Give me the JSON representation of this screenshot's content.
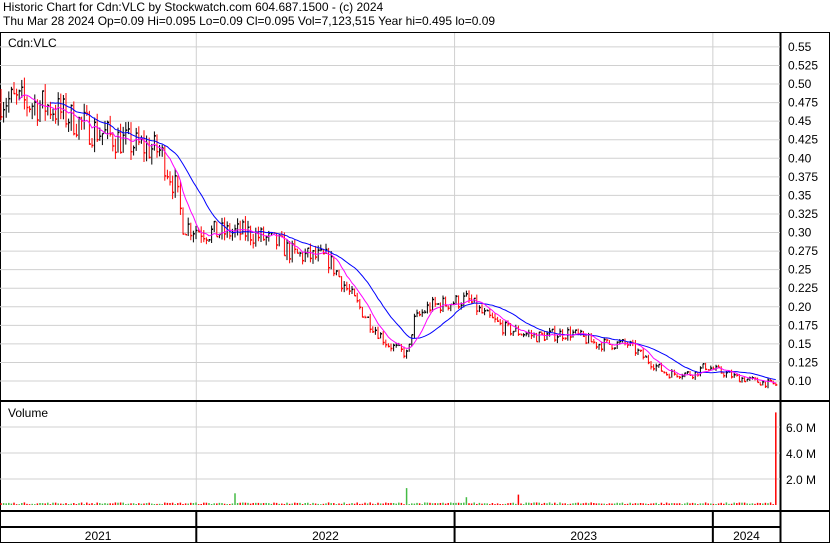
{
  "header": {
    "title": "Historic Chart for Cdn:VLC by Stockwatch.com 604.687.1500 - (c) 2024",
    "quote": "Thu Mar 28 2024   Op=0.09  Hi=0.095  Lo=0.09  Cl=0.095  Vol=7,123,515   Year hi=0.495  lo=0.09"
  },
  "chart_data": {
    "type": "line",
    "title": "Cdn:VLC",
    "price_pane": {
      "label": "Cdn:VLC",
      "ylim": [
        0.085,
        0.565
      ],
      "y_ticks": [
        "0.55",
        "0.525",
        "0.50",
        "0.475",
        "0.45",
        "0.425",
        "0.40",
        "0.375",
        "0.35",
        "0.325",
        "0.30",
        "0.275",
        "0.25",
        "0.225",
        "0.20",
        "0.175",
        "0.15",
        "0.125",
        "0.10"
      ],
      "series_colors": {
        "bars_up": "#000000",
        "bars_down": "#ff0000",
        "ma_short": "#ff00ff",
        "ma_long": "#0000ff"
      },
      "close_keypoints": {
        "x_year": [
          2021.24,
          2021.43,
          2021.59,
          2021.74,
          2021.86,
          2021.92,
          2021.95,
          2022.05,
          2022.2,
          2022.32,
          2022.38,
          2022.51,
          2022.59,
          2022.67,
          2022.74,
          2022.82,
          2022.84,
          2022.9,
          2023.05,
          2023.11,
          2023.2,
          2023.32,
          2023.45,
          2023.55,
          2023.67,
          2023.74,
          2023.82,
          2023.93,
          2023.97,
          2024.09,
          2024.24
        ],
        "close": [
          0.48,
          0.47,
          0.44,
          0.42,
          0.41,
          0.36,
          0.31,
          0.3,
          0.3,
          0.285,
          0.27,
          0.265,
          0.22,
          0.18,
          0.15,
          0.135,
          0.18,
          0.2,
          0.21,
          0.19,
          0.17,
          0.16,
          0.165,
          0.15,
          0.15,
          0.13,
          0.11,
          0.11,
          0.12,
          0.105,
          0.095
        ]
      }
    },
    "volume_pane": {
      "label": "Volume",
      "ylim": [
        0,
        7500000
      ],
      "y_ticks": [
        "6.0 M",
        "4.0 M",
        "2.0 M"
      ],
      "spikes": [
        {
          "x_year": 2022.15,
          "volume": 900000
        },
        {
          "x_year": 2022.81,
          "volume": 1300000
        },
        {
          "x_year": 2023.05,
          "volume": 600000
        },
        {
          "x_year": 2023.25,
          "volume": 800000
        },
        {
          "x_year": 2024.24,
          "volume": 7123515
        }
      ],
      "colors": {
        "up": "#44bb44",
        "down": "#ff0000"
      }
    },
    "x_axis": {
      "xlim": [
        2021.24,
        2024.26
      ],
      "labels": [
        "2021",
        "2022",
        "2023",
        "2024"
      ]
    }
  }
}
